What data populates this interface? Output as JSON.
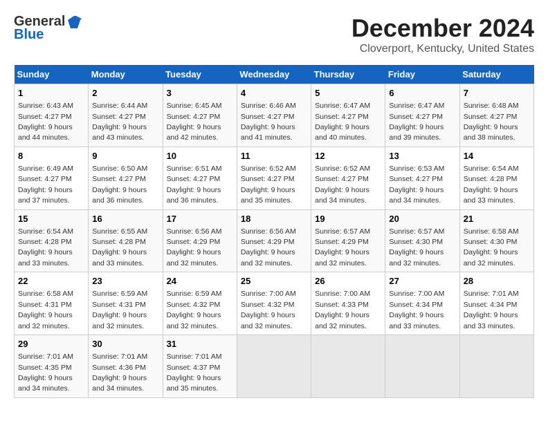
{
  "logo": {
    "line1": "General",
    "line2": "Blue"
  },
  "title": "December 2024",
  "subtitle": "Cloverport, Kentucky, United States",
  "days_of_week": [
    "Sunday",
    "Monday",
    "Tuesday",
    "Wednesday",
    "Thursday",
    "Friday",
    "Saturday"
  ],
  "weeks": [
    [
      {
        "day": "1",
        "sunrise": "6:43 AM",
        "sunset": "4:27 PM",
        "daylight": "9 hours and 44 minutes."
      },
      {
        "day": "2",
        "sunrise": "6:44 AM",
        "sunset": "4:27 PM",
        "daylight": "9 hours and 43 minutes."
      },
      {
        "day": "3",
        "sunrise": "6:45 AM",
        "sunset": "4:27 PM",
        "daylight": "9 hours and 42 minutes."
      },
      {
        "day": "4",
        "sunrise": "6:46 AM",
        "sunset": "4:27 PM",
        "daylight": "9 hours and 41 minutes."
      },
      {
        "day": "5",
        "sunrise": "6:47 AM",
        "sunset": "4:27 PM",
        "daylight": "9 hours and 40 minutes."
      },
      {
        "day": "6",
        "sunrise": "6:47 AM",
        "sunset": "4:27 PM",
        "daylight": "9 hours and 39 minutes."
      },
      {
        "day": "7",
        "sunrise": "6:48 AM",
        "sunset": "4:27 PM",
        "daylight": "9 hours and 38 minutes."
      }
    ],
    [
      {
        "day": "8",
        "sunrise": "6:49 AM",
        "sunset": "4:27 PM",
        "daylight": "9 hours and 37 minutes."
      },
      {
        "day": "9",
        "sunrise": "6:50 AM",
        "sunset": "4:27 PM",
        "daylight": "9 hours and 36 minutes."
      },
      {
        "day": "10",
        "sunrise": "6:51 AM",
        "sunset": "4:27 PM",
        "daylight": "9 hours and 36 minutes."
      },
      {
        "day": "11",
        "sunrise": "6:52 AM",
        "sunset": "4:27 PM",
        "daylight": "9 hours and 35 minutes."
      },
      {
        "day": "12",
        "sunrise": "6:52 AM",
        "sunset": "4:27 PM",
        "daylight": "9 hours and 34 minutes."
      },
      {
        "day": "13",
        "sunrise": "6:53 AM",
        "sunset": "4:27 PM",
        "daylight": "9 hours and 34 minutes."
      },
      {
        "day": "14",
        "sunrise": "6:54 AM",
        "sunset": "4:28 PM",
        "daylight": "9 hours and 33 minutes."
      }
    ],
    [
      {
        "day": "15",
        "sunrise": "6:54 AM",
        "sunset": "4:28 PM",
        "daylight": "9 hours and 33 minutes."
      },
      {
        "day": "16",
        "sunrise": "6:55 AM",
        "sunset": "4:28 PM",
        "daylight": "9 hours and 33 minutes."
      },
      {
        "day": "17",
        "sunrise": "6:56 AM",
        "sunset": "4:29 PM",
        "daylight": "9 hours and 32 minutes."
      },
      {
        "day": "18",
        "sunrise": "6:56 AM",
        "sunset": "4:29 PM",
        "daylight": "9 hours and 32 minutes."
      },
      {
        "day": "19",
        "sunrise": "6:57 AM",
        "sunset": "4:29 PM",
        "daylight": "9 hours and 32 minutes."
      },
      {
        "day": "20",
        "sunrise": "6:57 AM",
        "sunset": "4:30 PM",
        "daylight": "9 hours and 32 minutes."
      },
      {
        "day": "21",
        "sunrise": "6:58 AM",
        "sunset": "4:30 PM",
        "daylight": "9 hours and 32 minutes."
      }
    ],
    [
      {
        "day": "22",
        "sunrise": "6:58 AM",
        "sunset": "4:31 PM",
        "daylight": "9 hours and 32 minutes."
      },
      {
        "day": "23",
        "sunrise": "6:59 AM",
        "sunset": "4:31 PM",
        "daylight": "9 hours and 32 minutes."
      },
      {
        "day": "24",
        "sunrise": "6:59 AM",
        "sunset": "4:32 PM",
        "daylight": "9 hours and 32 minutes."
      },
      {
        "day": "25",
        "sunrise": "7:00 AM",
        "sunset": "4:32 PM",
        "daylight": "9 hours and 32 minutes."
      },
      {
        "day": "26",
        "sunrise": "7:00 AM",
        "sunset": "4:33 PM",
        "daylight": "9 hours and 32 minutes."
      },
      {
        "day": "27",
        "sunrise": "7:00 AM",
        "sunset": "4:34 PM",
        "daylight": "9 hours and 33 minutes."
      },
      {
        "day": "28",
        "sunrise": "7:01 AM",
        "sunset": "4:34 PM",
        "daylight": "9 hours and 33 minutes."
      }
    ],
    [
      {
        "day": "29",
        "sunrise": "7:01 AM",
        "sunset": "4:35 PM",
        "daylight": "9 hours and 34 minutes."
      },
      {
        "day": "30",
        "sunrise": "7:01 AM",
        "sunset": "4:36 PM",
        "daylight": "9 hours and 34 minutes."
      },
      {
        "day": "31",
        "sunrise": "7:01 AM",
        "sunset": "4:37 PM",
        "daylight": "9 hours and 35 minutes."
      },
      null,
      null,
      null,
      null
    ]
  ]
}
